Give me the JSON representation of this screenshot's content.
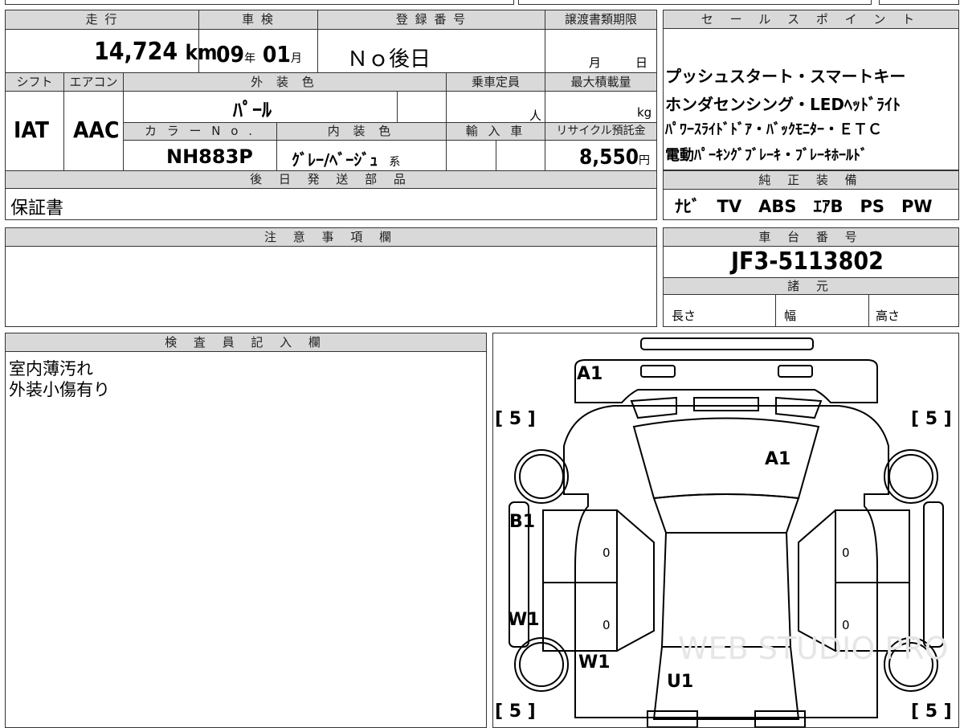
{
  "main_table": {
    "headers": {
      "mileage": "走 行",
      "inspection": "車 検",
      "registration_no": "登 録 番 号",
      "transfer_deadline": "譲渡書類期限",
      "shift": "シフト",
      "aircon": "エアコン",
      "exterior_color": "外 装 色",
      "capacity": "乗車定員",
      "max_load": "最大積載量",
      "color_no": "カ ラ ー N o .",
      "interior_color": "内 装 色",
      "import": "輸 入 車",
      "recycle_fee": "リサイクル預託金",
      "later_parts": "後 日 発 送 部 品"
    },
    "values": {
      "mileage": "14,724",
      "mileage_unit": "km",
      "inspection_year": "09",
      "year_unit": "年",
      "inspection_month": "01",
      "month_unit": "月",
      "registration": "Ｎｏ後日",
      "deadline_month": "月",
      "deadline_day": "日",
      "shift": "IAT",
      "aircon": "AAC",
      "exterior_color": "ﾊﾟｰﾙ",
      "capacity_unit": "人",
      "max_load_unit": "kg",
      "color_no": "NH883P",
      "interior_color": "ｸﾞﾚｰ/ﾍﾞｰｼﾞｭ",
      "interior_suffix": "系",
      "recycle_fee": "8,550",
      "recycle_unit": "円",
      "later_parts": "保証書"
    }
  },
  "sales_points": {
    "header": "セ ー ル ス ポ イ ン ト",
    "lines": [
      "プッシュスタート・スマートキー",
      "ホンダセンシング・LEDﾍｯﾄﾞﾗｲﾄ",
      "ﾊﾟﾜｰｽﾗｲﾄﾞﾄﾞｱ・ﾊﾞｯｸﾓﾆﾀｰ・ＥＴＣ",
      "電動ﾊﾟｰｷﾝｸﾞﾌﾞﾚｰｷ・ﾌﾞﾚｰｷﾎｰﾙﾄﾞ"
    ]
  },
  "genuine_equipment": {
    "header": "純 正 装 備",
    "value": "ﾅﾋﾞ　TV　ABS　ｴｱB　PS　PW"
  },
  "notes": {
    "header": "注 意 事 項 欄",
    "value": ""
  },
  "chassis": {
    "header": "車 台 番 号",
    "value": "JF3-5113802",
    "specs_header": "諸 元",
    "length": "長さ",
    "width": "幅",
    "height": "高さ"
  },
  "inspector": {
    "header": "検 査 員 記 入 欄",
    "lines": [
      "室内薄汚れ",
      "外装小傷有り"
    ]
  },
  "diagram": {
    "labels": {
      "roof_front": "A1",
      "hood": "A1",
      "left_front_door": "B1",
      "left_rear": "W1",
      "rear_left": "W1",
      "rear": "U1",
      "tire_fl": "[ 5 ]",
      "tire_fr": "[ 5 ]",
      "tire_rl": "[ 5 ]",
      "tire_rr": "[ 5 ]",
      "door_fl_val": "0",
      "door_fr_val": "0",
      "door_rl_val": "0",
      "door_rr_val": "0"
    },
    "watermark": "WEB STUDIO PRO"
  }
}
